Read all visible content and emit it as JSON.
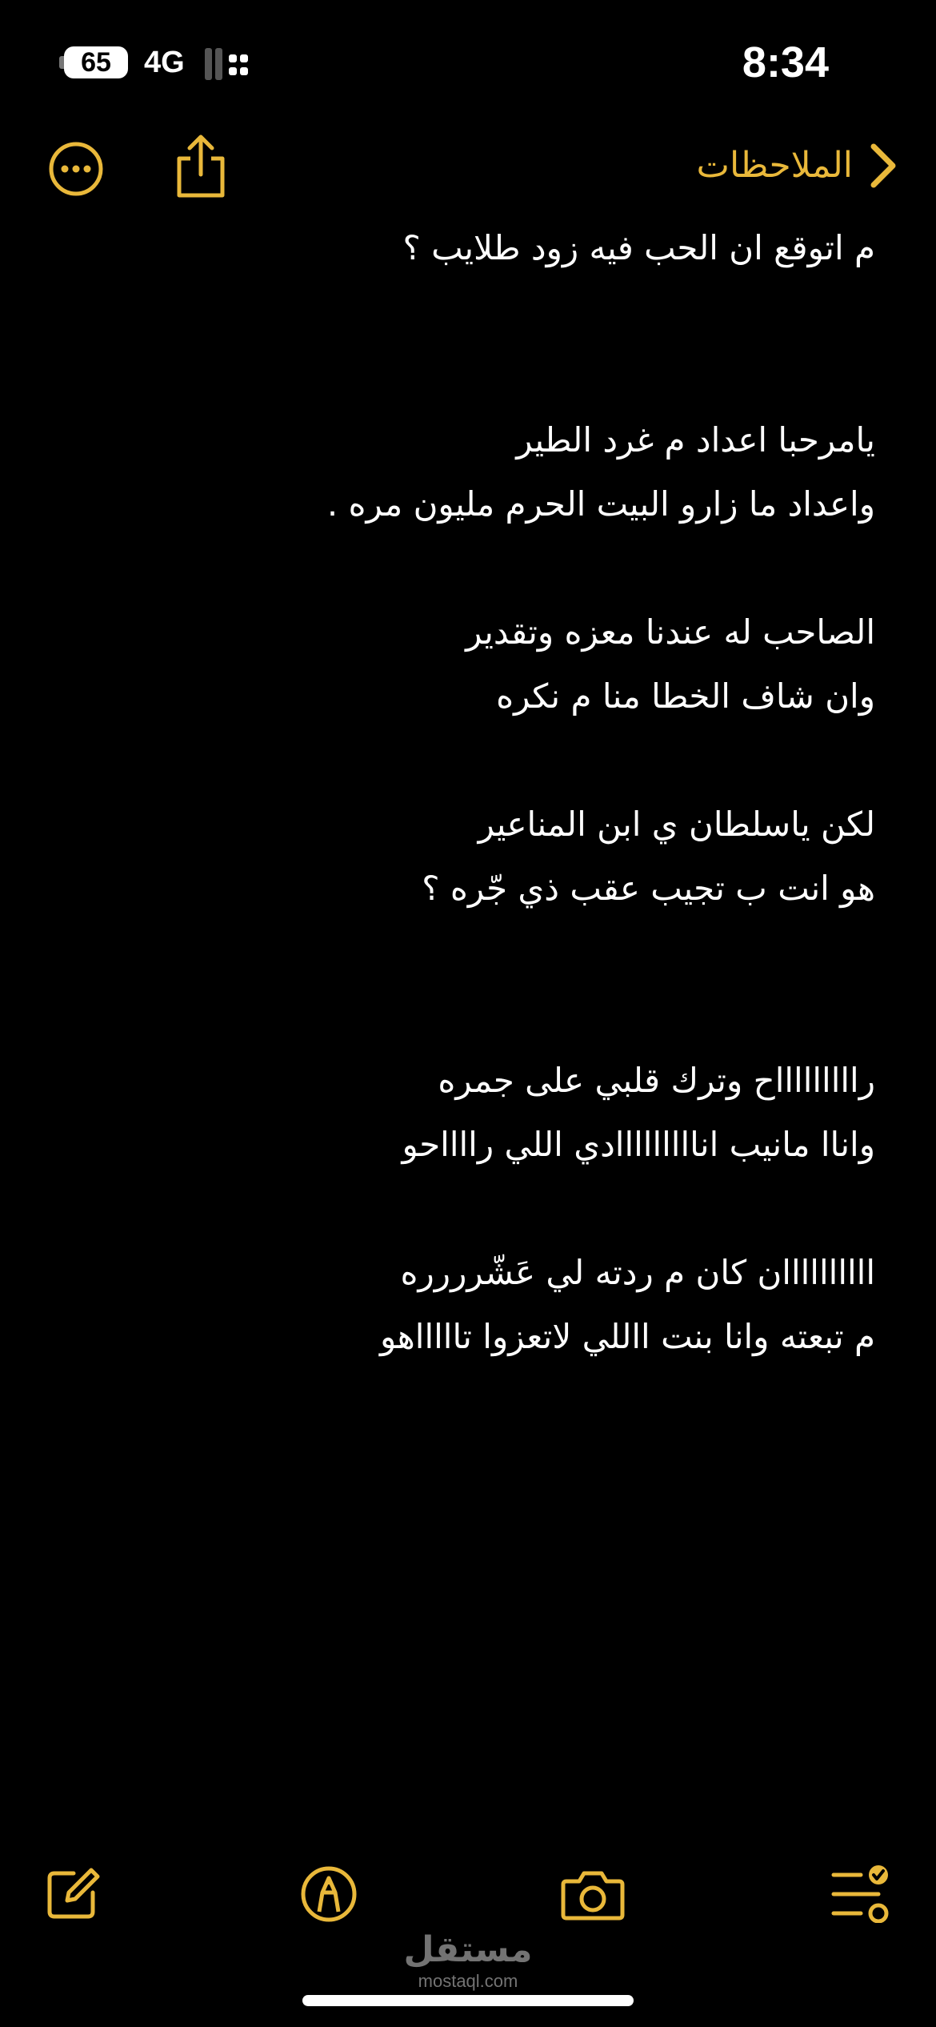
{
  "status_bar": {
    "battery": "65",
    "network": "4G",
    "time": "8:34"
  },
  "nav": {
    "back_label": "الملاحظات",
    "more_icon": "ellipsis-circle-icon",
    "share_icon": "share-icon",
    "back_icon": "chevron-right-icon"
  },
  "note": {
    "lines": [
      "م اتوقع ان الحب فيه زود طلايب ؟",
      "",
      "",
      "يامرحبا اعداد م غرد الطير",
      "واعداد ما زارو البيت الحرم مليون مره .",
      "",
      "الصاحب له عندنا معزه وتقدير",
      "وان شاف الخطا منا م نكره",
      "",
      "لكن ياسلطان ي ابن المناعير",
      "هو انت ب تجيب عقب ذي جّره ؟",
      "",
      "",
      "راااااااااح وترك قلبي على جمره",
      "واناا مانيب انااااااااادي اللي رااااحو",
      "",
      "اااااااااان كان م ردته لي عَشّرررره",
      "م تبعته وانا بنت االلي لاتعزوا تاااااهو"
    ]
  },
  "toolbar": {
    "compose_icon": "compose-icon",
    "markup_icon": "markup-pen-icon",
    "camera_icon": "camera-icon",
    "checklist_icon": "checklist-icon"
  },
  "watermark": {
    "arabic": "مستقل",
    "latin": "mostaql.com"
  },
  "colors": {
    "accent": "#E9B83A",
    "background": "#000000",
    "text": "#FFFFFF"
  }
}
